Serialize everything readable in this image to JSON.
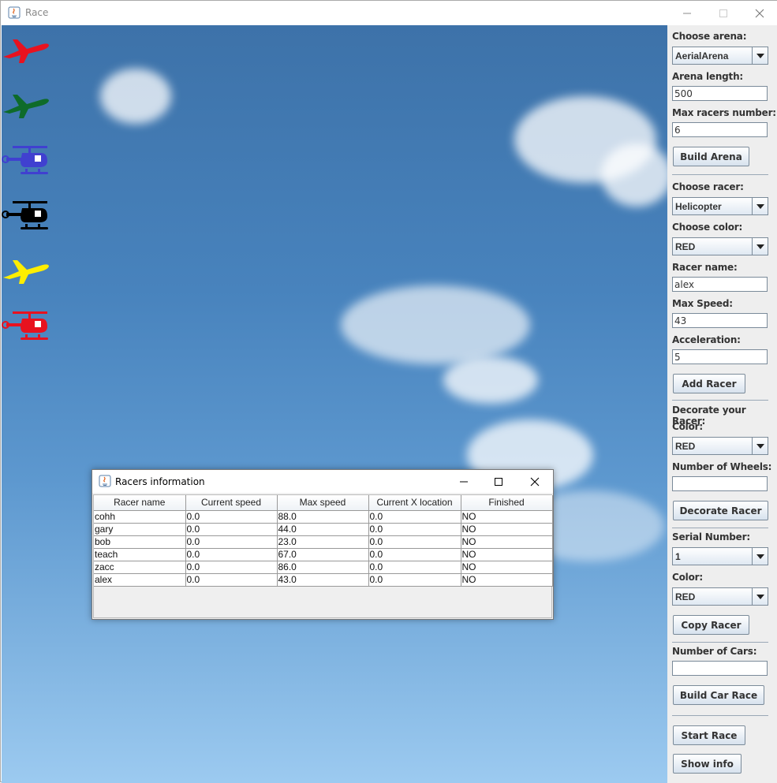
{
  "window": {
    "title": "Race"
  },
  "arena": {
    "racers": [
      {
        "kind": "airplane",
        "color": "#e8121f"
      },
      {
        "kind": "airplane",
        "color": "#0e6b2a"
      },
      {
        "kind": "helicopter",
        "color": "#4040d0"
      },
      {
        "kind": "helicopter",
        "color": "#000000"
      },
      {
        "kind": "airplane",
        "color": "#ffee00"
      },
      {
        "kind": "helicopter",
        "color": "#e8121f"
      }
    ]
  },
  "panel": {
    "arena_label": "Choose arena:",
    "arena_value": "AerialArena",
    "length_label": "Arena length:",
    "length_value": "500",
    "max_racers_label": "Max racers number:",
    "max_racers_value": "6",
    "build_arena": "Build Arena",
    "racer_label": "Choose racer:",
    "racer_value": "Helicopter",
    "color_label": "Choose color:",
    "color_value": "RED",
    "name_label": "Racer name:",
    "name_value": "alex",
    "speed_label": "Max Speed:",
    "speed_value": "43",
    "accel_label": "Acceleration:",
    "accel_value": "5",
    "add_racer": "Add Racer",
    "decorate_heading": "Decorate your Racer:",
    "decor_color_label": "Color:",
    "decor_color_value": "RED",
    "wheels_label": "Number of Wheels:",
    "wheels_value": "",
    "decorate_button": "Decorate Racer",
    "serial_label": "Serial Number:",
    "serial_value": "1",
    "copy_color_label": "Color:",
    "copy_color_value": "RED",
    "copy_button": "Copy Racer",
    "cars_label": "Number of Cars:",
    "cars_value": "",
    "build_car_race": "Build Car Race",
    "start_race": "Start Race",
    "show_info": "Show info"
  },
  "dialog": {
    "title": "Racers information",
    "columns": [
      "Racer name",
      "Current speed",
      "Max speed",
      "Current X location",
      "Finished"
    ],
    "rows": [
      [
        "cohh",
        "0.0",
        "88.0",
        "0.0",
        "NO"
      ],
      [
        "gary",
        "0.0",
        "44.0",
        "0.0",
        "NO"
      ],
      [
        "bob",
        "0.0",
        "23.0",
        "0.0",
        "NO"
      ],
      [
        "teach",
        "0.0",
        "67.0",
        "0.0",
        "NO"
      ],
      [
        "zacc",
        "0.0",
        "86.0",
        "0.0",
        "NO"
      ],
      [
        "alex",
        "0.0",
        "43.0",
        "0.0",
        "NO"
      ]
    ]
  },
  "colors": {
    "sky_top": "#3d72a9",
    "sky_bottom": "#9ccaf0",
    "panel_bg": "#eeeeee"
  }
}
